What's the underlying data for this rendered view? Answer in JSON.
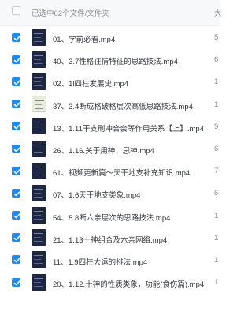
{
  "header": {
    "selected_label": "已选中62个文件/文件夹",
    "size_col": "大"
  },
  "colors": {
    "accent": "#1a8cff",
    "header_bg": "#f7f8fa"
  },
  "files": [
    {
      "name": "01、学前必看.mp4",
      "size": "5",
      "thumb": "dark"
    },
    {
      "name": "40、3.7性格往情特征的思路技法.mp4",
      "size": "6",
      "thumb": "dark"
    },
    {
      "name": "02、1l四柱发展史.mp4",
      "size": "1",
      "thumb": "dark"
    },
    {
      "name": "37、3.4断成格破格层次高低思路技法.mp4",
      "size": "1",
      "thumb": "light"
    },
    {
      "name": "13、1.11干支刑冲合会等作用关系【上】.mp4",
      "size": "9",
      "thumb": "dark"
    },
    {
      "name": "26、1.16.关于用神、忌神.mp4",
      "size": "6",
      "thumb": "dark"
    },
    {
      "name": "61、视频更新篇～天干地支补充知识.mp4",
      "size": "7",
      "thumb": "dark"
    },
    {
      "name": "07、1.6天干地支类象.mp4",
      "size": "6",
      "thumb": "dark"
    },
    {
      "name": "54、5.8断六亲层次的思路技法.mp4",
      "size": "1",
      "thumb": "dark"
    },
    {
      "name": "21、1.13十神组合及六亲网络.mp4",
      "size": "1",
      "thumb": "dark"
    },
    {
      "name": "11、1.9四柱大运的排法.mp4",
      "size": "1",
      "thumb": "dark"
    },
    {
      "name": "20、1.12.十神的性质类象，功能(食伤篇).mp4",
      "size": "1",
      "thumb": "dark"
    }
  ]
}
